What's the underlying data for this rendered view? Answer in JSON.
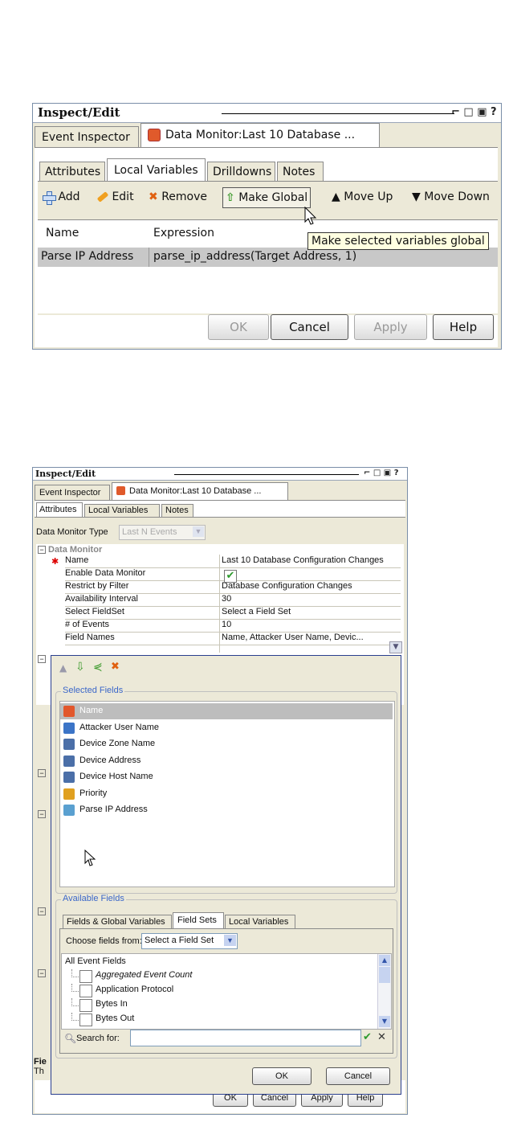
{
  "top": {
    "title": "Inspect/Edit",
    "tab_inspector": "Event Inspector",
    "tab_monitor": "Data Monitor:Last 10 Database ...",
    "subtabs": [
      "Attributes",
      "Local Variables",
      "Drilldowns",
      "Notes"
    ],
    "toolbar": {
      "add": "Add",
      "edit": "Edit",
      "remove": "Remove",
      "make_global": "Make Global",
      "move_up": "Move Up",
      "move_down": "Move Down"
    },
    "columns": [
      "Name",
      "Expression"
    ],
    "rows": [
      {
        "name": "Parse IP Address",
        "expression": "parse_ip_address(Target Address, 1)"
      }
    ],
    "tooltip": "Make selected variables global",
    "buttons": {
      "ok": "OK",
      "cancel": "Cancel",
      "apply": "Apply",
      "help": "Help"
    }
  },
  "bottom": {
    "title": "Inspect/Edit",
    "tab_inspector": "Event Inspector",
    "tab_monitor": "Data Monitor:Last 10 Database ...",
    "subtabs": [
      "Attributes",
      "Local Variables",
      "Notes"
    ],
    "type_label": "Data Monitor Type",
    "type_value": "Last N Events",
    "section": "Data Monitor",
    "props": [
      {
        "label": "Name",
        "value": "Last 10 Database Configuration Changes"
      },
      {
        "label": "Enable Data Monitor",
        "value": ""
      },
      {
        "label": "Restrict by Filter",
        "value": "Database Configuration Changes"
      },
      {
        "label": "Availability Interval",
        "value": "30"
      },
      {
        "label": "Select FieldSet",
        "value": "Select a Field Set"
      },
      {
        "label": "# of Events",
        "value": "10"
      },
      {
        "label": "Field Names",
        "value": "Name, Attacker User Name, Devic..."
      }
    ],
    "selected_fields_label": "Selected Fields",
    "selected_fields": [
      "Name",
      "Attacker User Name",
      "Device Zone Name",
      "Device Address",
      "Device Host Name",
      "Priority",
      "Parse IP Address"
    ],
    "available_fields_label": "Available Fields",
    "avail_tabs": [
      "Fields & Global Variables",
      "Field Sets",
      "Local Variables"
    ],
    "choose_label": "Choose fields from:",
    "choose_value": "Select a Field Set",
    "tree_root": "All Event Fields",
    "tree_items": [
      "Aggregated Event Count",
      "Application Protocol",
      "Bytes In",
      "Bytes Out"
    ],
    "search_label": "Search for:",
    "popup_ok": "OK",
    "popup_cancel": "Cancel",
    "footer_label": "Fie",
    "footer_text": "Th",
    "buttons": {
      "ok": "OK",
      "cancel": "Cancel",
      "apply": "Apply",
      "help": "Help"
    }
  },
  "colors": {
    "tab_accent": "#f5a623",
    "group_label": "#3b67c9",
    "selected_row": "#bdbdbd",
    "tooltip_bg": "#ffffe1"
  }
}
